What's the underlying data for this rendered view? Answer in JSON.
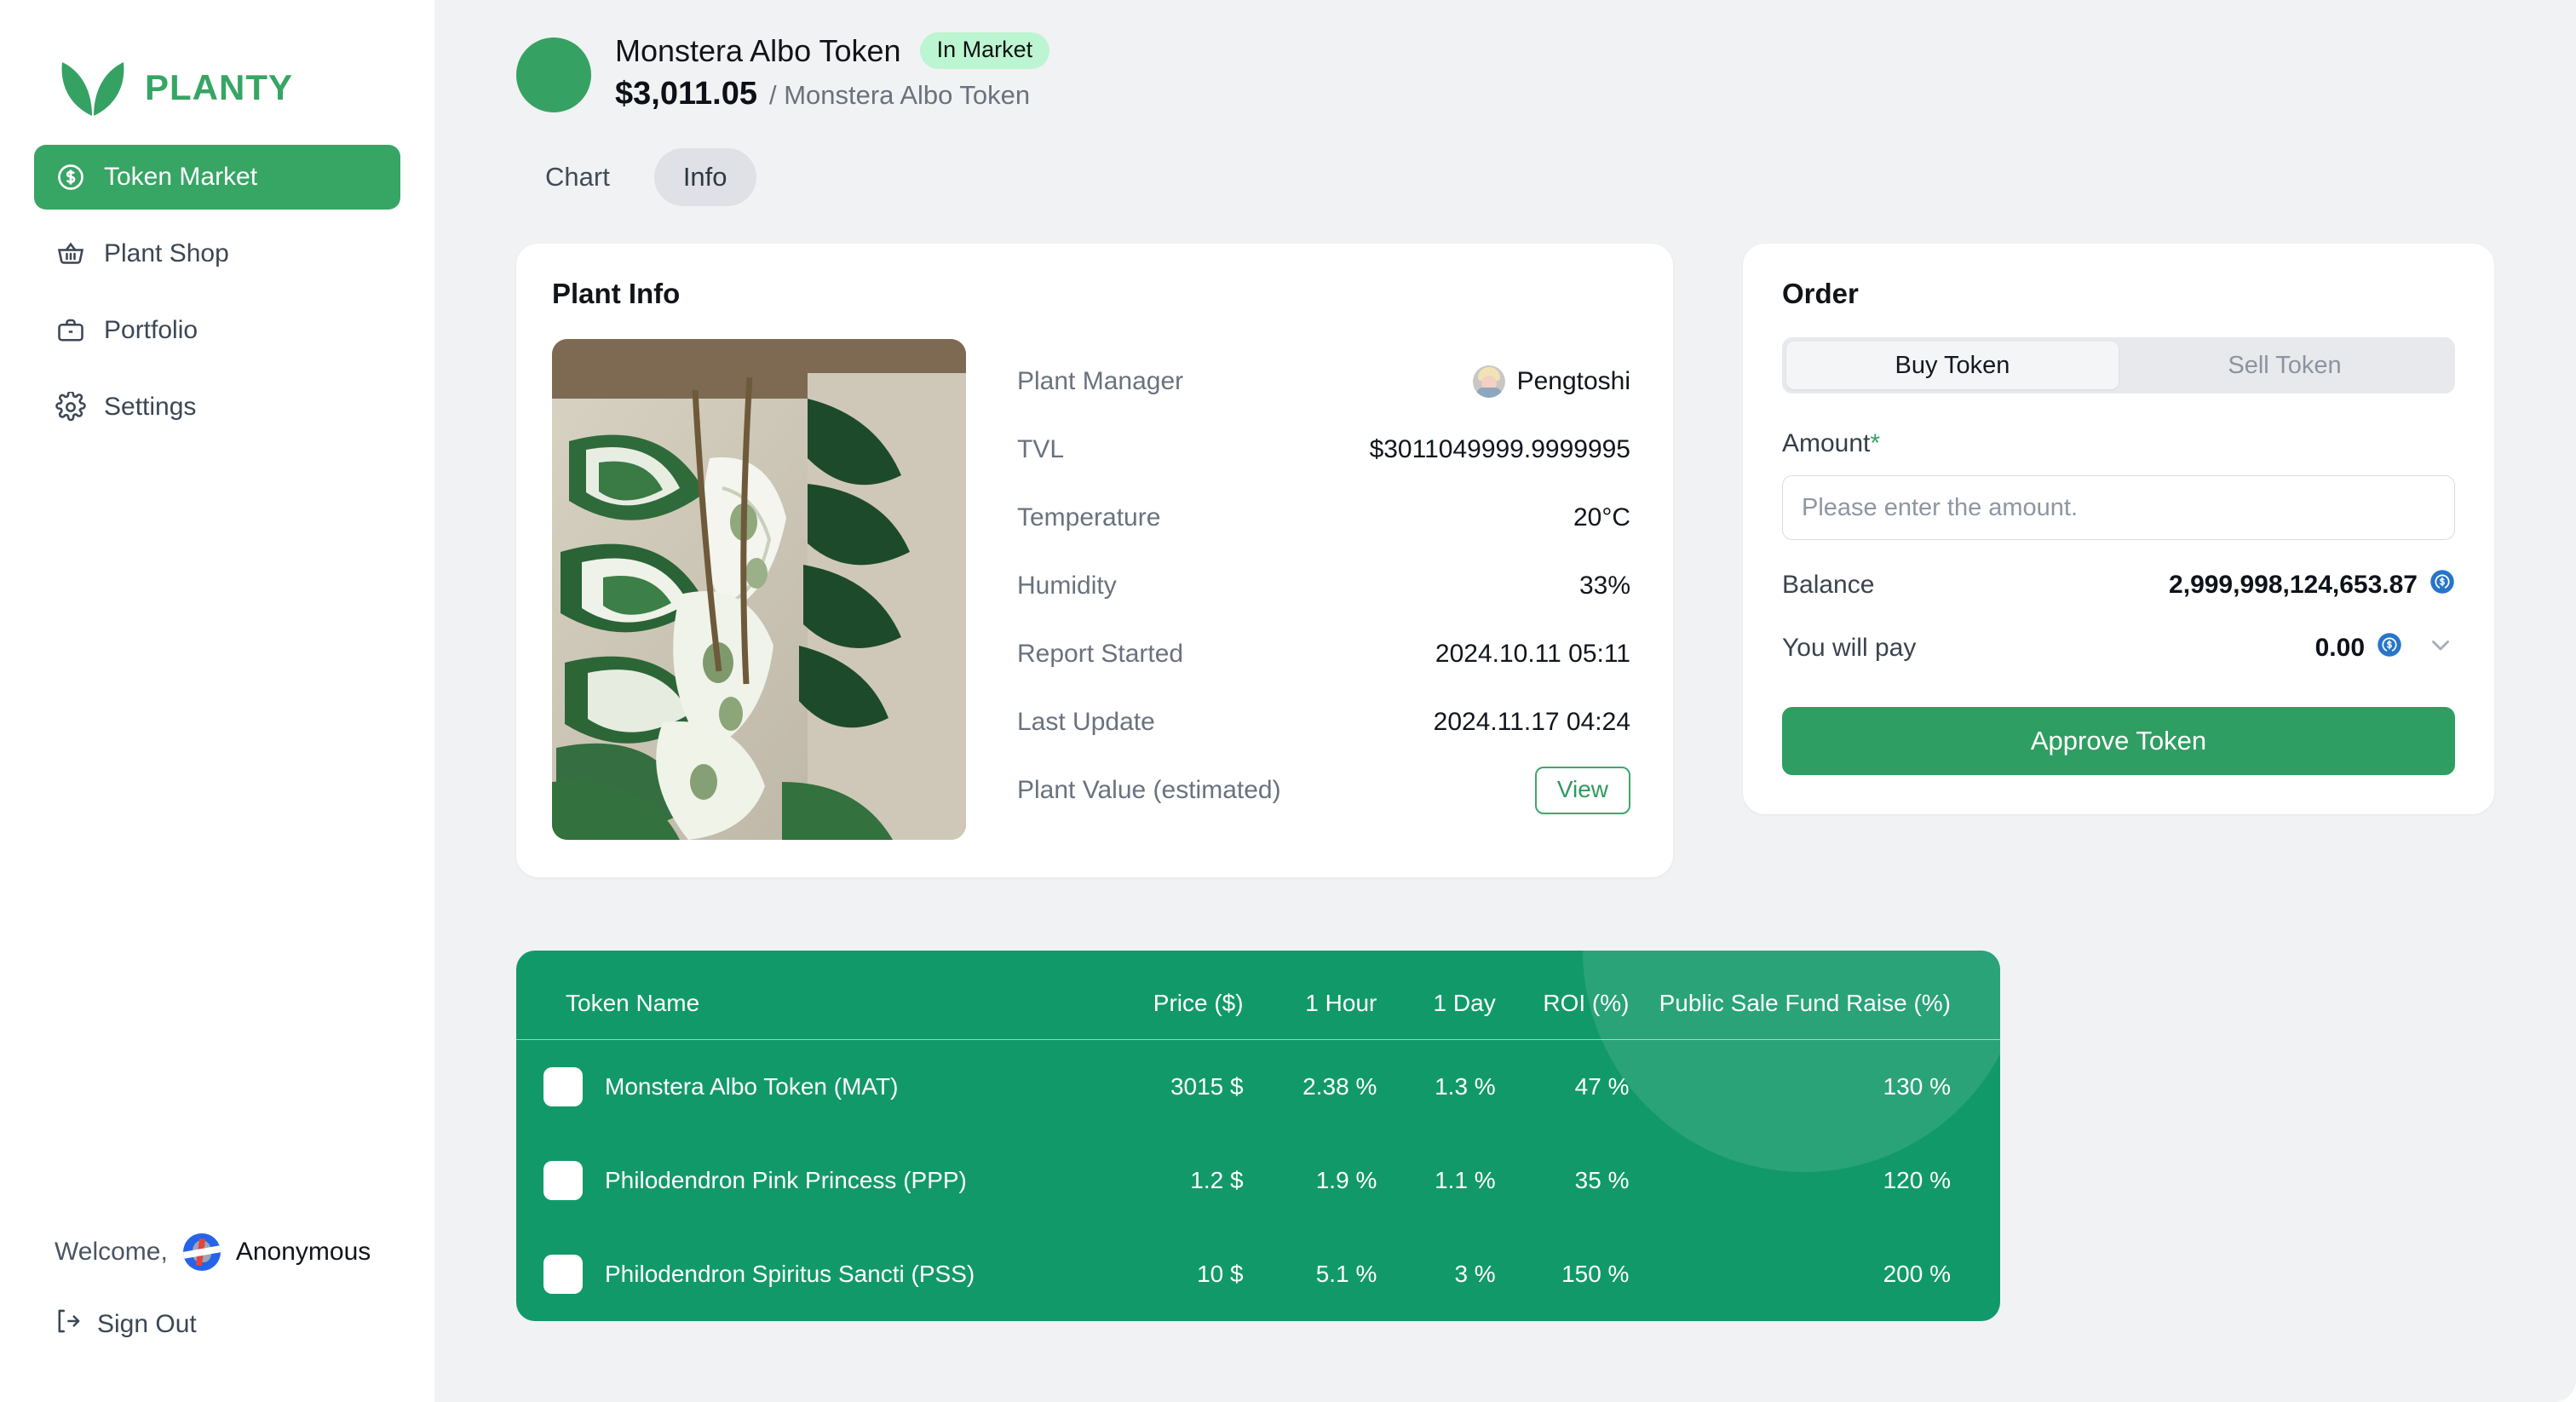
{
  "brand": {
    "name": "PLANTY",
    "logo_icon": "two-leaves-icon",
    "accent": "#37A564"
  },
  "sidebar": {
    "items": [
      {
        "label": "Token Market",
        "icon": "dollar-circle-icon",
        "active": true
      },
      {
        "label": "Plant Shop",
        "icon": "shopping-basket-icon",
        "active": false
      },
      {
        "label": "Portfolio",
        "icon": "briefcase-icon",
        "active": false
      },
      {
        "label": "Settings",
        "icon": "gear-icon",
        "active": false
      }
    ],
    "welcome_label": "Welcome,",
    "user_name": "Anonymous",
    "user_avatar_icon": "wallet-avatar-icon",
    "sign_out_label": "Sign Out",
    "sign_out_icon": "sign-out-icon"
  },
  "header": {
    "token_symbol_icon": "green-token-circle",
    "token_title": "Monstera Albo Token",
    "status_badge": "In Market",
    "status_badge_bg": "#BCF5D2",
    "price": "$3,011.05",
    "pair": "/ Monstera Albo Token"
  },
  "tabs": [
    {
      "label": "Chart",
      "active": false
    },
    {
      "label": "Info",
      "active": true
    }
  ],
  "plant_info": {
    "title": "Plant Info",
    "photo_alt": "monstera-albo-plant-photo",
    "rows": [
      {
        "label": "Plant Manager",
        "value": "Pengtoshi",
        "icon": "manager-avatar"
      },
      {
        "label": "TVL",
        "value": "$3011049999.9999995"
      },
      {
        "label": "Temperature",
        "value": "20°C"
      },
      {
        "label": "Humidity",
        "value": "33%"
      },
      {
        "label": "Report Started",
        "value": "2024.10.11 05:11"
      },
      {
        "label": "Last Update",
        "value": "2024.11.17 04:24"
      },
      {
        "label": "Plant Value (estimated)",
        "value": "",
        "button": "View"
      }
    ]
  },
  "order": {
    "title": "Order",
    "segments": [
      {
        "label": "Buy Token",
        "active": true
      },
      {
        "label": "Sell Token",
        "active": false
      }
    ],
    "amount_label": "Amount",
    "amount_required_mark": "*",
    "amount_value": "",
    "amount_placeholder": "Please enter the amount.",
    "balance_label": "Balance",
    "balance_value": "2,999,998,124,653.87",
    "balance_token_icon": "usdc-coin-icon",
    "pay_label": "You will pay",
    "pay_value": "0.00",
    "pay_token_icon": "usdc-coin-icon",
    "pay_chevron_icon": "chevron-down-icon",
    "approve_label": "Approve Token",
    "approve_color": "#2F9E62"
  },
  "token_table": {
    "background": "#12996A",
    "columns": [
      "Token Name",
      "Price ($)",
      "1 Hour",
      "1 Day",
      "ROI (%)",
      "Public Sale Fund Raise (%)"
    ],
    "rows": [
      {
        "icon": "token-square-icon",
        "name": "Monstera Albo Token (MAT)",
        "price": "3015 $",
        "hour": "2.38 %",
        "day": "1.3 %",
        "roi": "47 %",
        "fund_raise": "130 %"
      },
      {
        "icon": "token-square-icon",
        "name": "Philodendron Pink Princess (PPP)",
        "price": "1.2 $",
        "hour": "1.9 %",
        "day": "1.1 %",
        "roi": "35 %",
        "fund_raise": "120 %"
      },
      {
        "icon": "token-square-icon",
        "name": "Philodendron Spiritus Sancti (PSS)",
        "price": "10 $",
        "hour": "5.1 %",
        "day": "3 %",
        "roi": "150 %",
        "fund_raise": "200 %"
      }
    ]
  }
}
